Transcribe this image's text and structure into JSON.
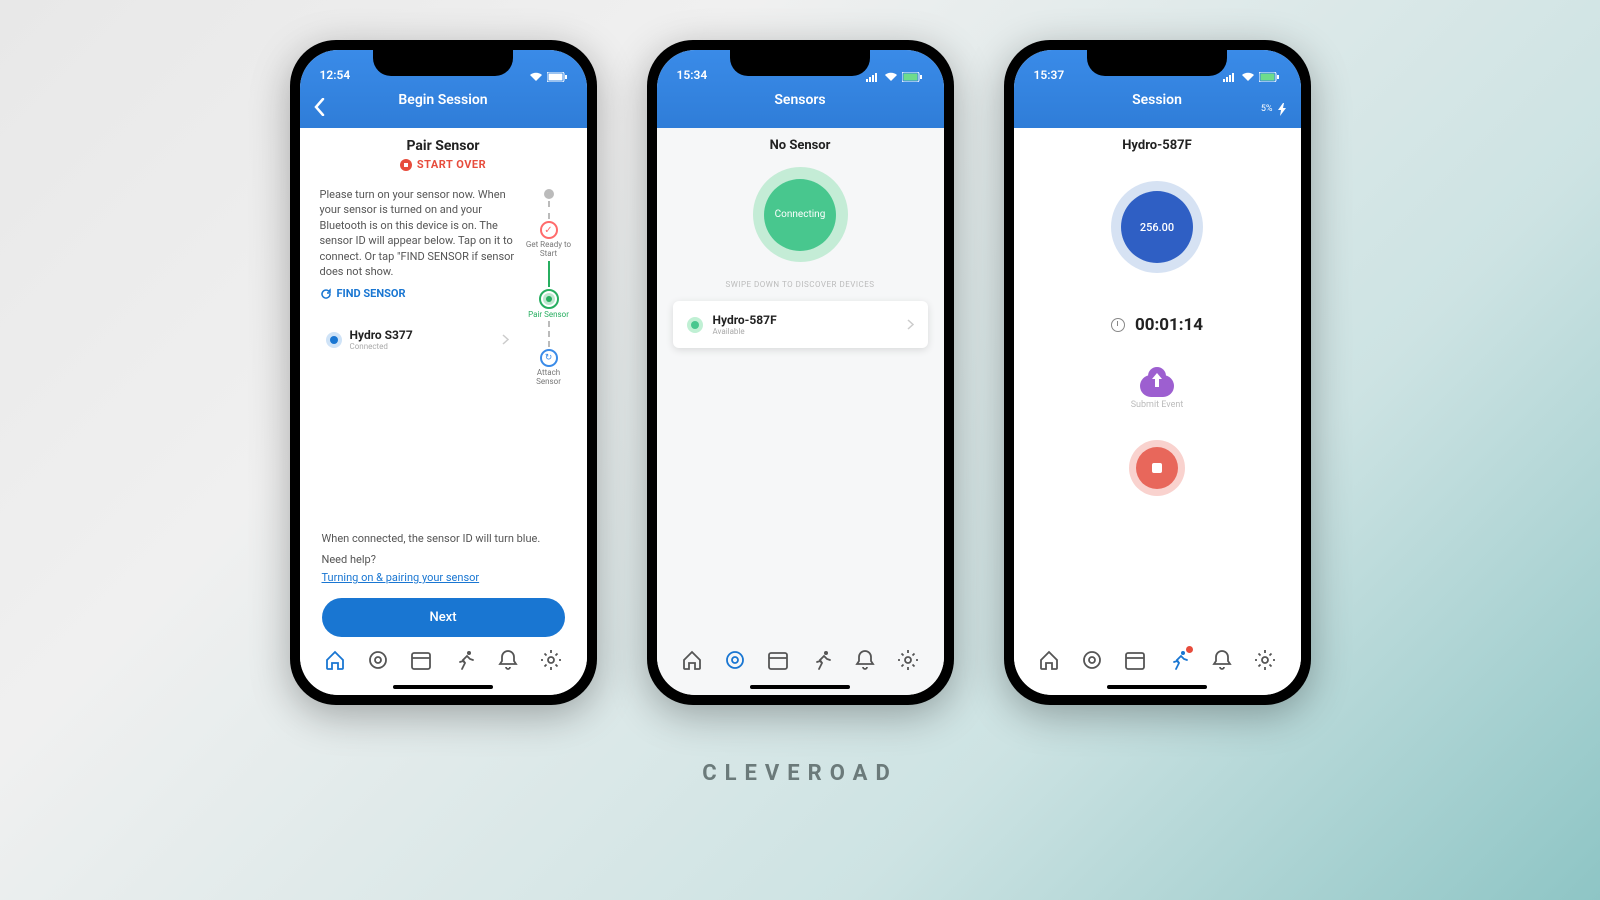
{
  "brand": "CLEVEROAD",
  "screen1": {
    "time": "12:54",
    "header": "Begin Session",
    "subtitle": "Pair Sensor",
    "start_over": "START OVER",
    "instructions": "Please turn on your sensor now. When your sensor is turned on and your Bluetooth is on this device is on. The sensor ID will appear below. Tap on it to connect. Or tap \"FIND SENSOR if sensor does not show.",
    "find_sensor": "FIND SENSOR",
    "sensor": {
      "name": "Hydro S377",
      "status": "Connected"
    },
    "steps": {
      "s1": "Get Ready to Start",
      "s2": "Pair Sensor",
      "s3": "Attach Sensor"
    },
    "connected_hint": "When connected, the sensor ID will turn blue.",
    "need_help": "Need help?",
    "help_link": "Turning on & pairing your sensor",
    "next": "Next"
  },
  "screen2": {
    "time": "15:34",
    "header": "Sensors",
    "subtitle": "No Sensor",
    "connecting": "Connecting",
    "swipe_hint": "SWIPE DOWN TO DISCOVER DEVICES",
    "sensor": {
      "name": "Hydro-587F",
      "status": "Available"
    }
  },
  "screen3": {
    "time": "15:37",
    "header": "Session",
    "battery": "5%",
    "sensor_name": "Hydro-587F",
    "value": "256.00",
    "timer": "00:01:14",
    "submit_label": "Submit Event"
  }
}
